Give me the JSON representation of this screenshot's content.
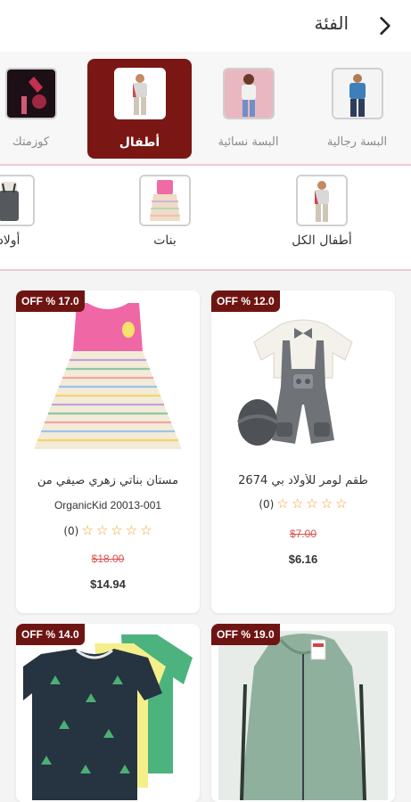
{
  "header": {
    "title": "الفئة"
  },
  "categories": [
    {
      "label": "البسة رجالية",
      "active": false
    },
    {
      "label": "البسة نسائية",
      "active": false
    },
    {
      "label": "أطفال",
      "active": true
    },
    {
      "label": "كوزمتك",
      "active": false
    }
  ],
  "subcategories": [
    {
      "label": "أطفال الكل"
    },
    {
      "label": "بنات"
    },
    {
      "label": "أولاد"
    }
  ],
  "products": [
    {
      "badge": "OFF % 12.0",
      "name_line1": "طقم لومر للأولاد بي 2674",
      "name_line2": "",
      "rating_count": "(0)",
      "old_price": "$7.00",
      "new_price": "$6.16"
    },
    {
      "badge": "OFF % 17.0",
      "name_line1": "مستان بناتي زهري صيفي من",
      "name_line2": "OrganicKid 20013-001",
      "rating_count": "(0)",
      "old_price": "$18.00",
      "new_price": "$14.94"
    },
    {
      "badge": "OFF % 19.0"
    },
    {
      "badge": "OFF % 14.0"
    }
  ],
  "colors": {
    "accent": "#7a1714",
    "badge": "#6e1513",
    "star": "#f2a12a",
    "old_price": "#d9534f"
  }
}
